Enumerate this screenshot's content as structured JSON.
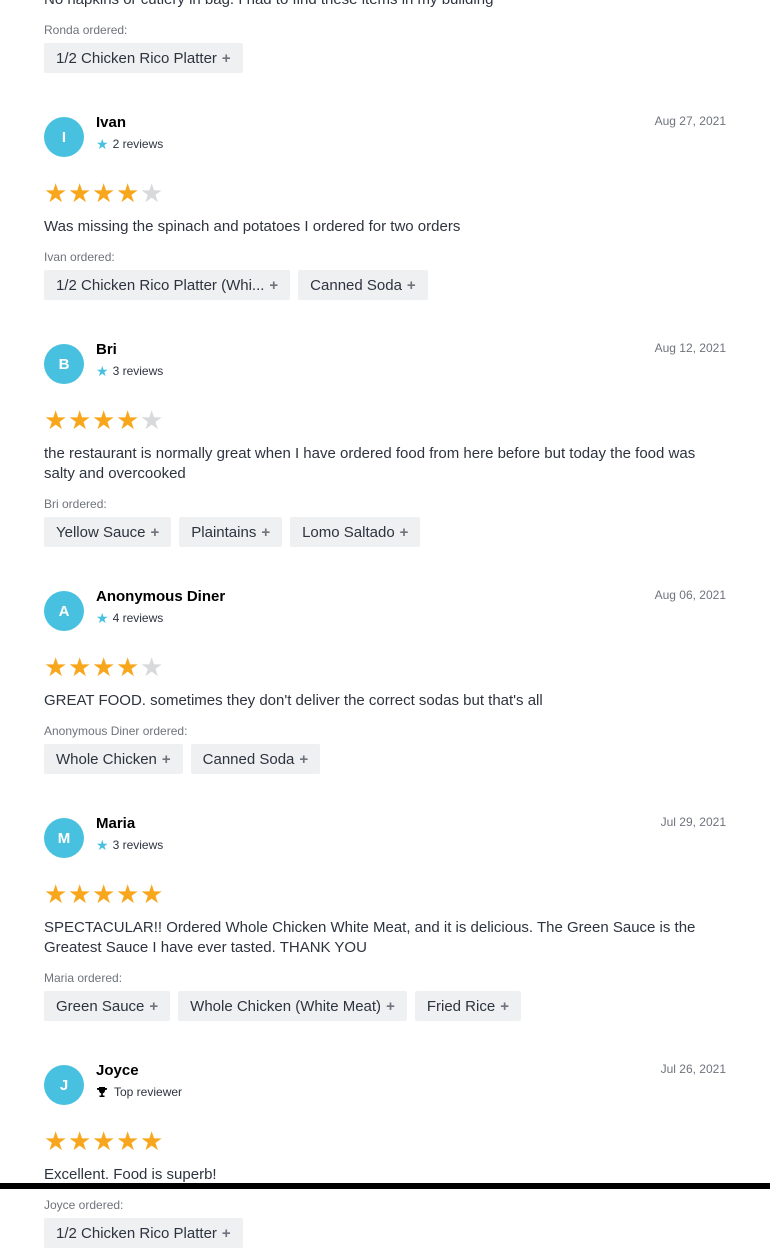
{
  "top": {
    "text": "No napkins or cutlery in bag. I had to find these items in my building",
    "ordered_label": "Ronda ordered:",
    "items": [
      "1/2 Chicken Rico Platter"
    ]
  },
  "reviews": [
    {
      "initial": "I",
      "name": "Ivan",
      "meta": "2 reviews",
      "date": "Aug 27, 2021",
      "rating": 4,
      "text": "Was missing the spinach and potatoes I ordered for two orders",
      "ordered_label": "Ivan ordered:",
      "items": [
        "1/2 Chicken Rico Platter (Whi...",
        "Canned Soda"
      ]
    },
    {
      "initial": "B",
      "name": "Bri",
      "meta": "3 reviews",
      "date": "Aug 12, 2021",
      "rating": 4,
      "text": "the restaurant is normally great when I have ordered food from here before but today the food was salty and overcooked",
      "ordered_label": "Bri ordered:",
      "items": [
        "Yellow Sauce",
        "Plaintains",
        "Lomo Saltado"
      ]
    },
    {
      "initial": "A",
      "name": "Anonymous Diner",
      "meta": "4 reviews",
      "date": "Aug 06, 2021",
      "rating": 4,
      "text": "GREAT FOOD. sometimes they don't deliver the correct sodas but that's all",
      "ordered_label": "Anonymous Diner ordered:",
      "items": [
        "Whole Chicken",
        "Canned Soda"
      ]
    },
    {
      "initial": "M",
      "name": "Maria",
      "meta": "3 reviews",
      "date": "Jul 29, 2021",
      "rating": 5,
      "text": "SPECTACULAR!! Ordered Whole Chicken White Meat, and it is delicious. The Green Sauce is the Greatest Sauce I have ever tasted. THANK YOU",
      "ordered_label": "Maria ordered:",
      "items": [
        "Green Sauce",
        "Whole Chicken (White Meat)",
        "Fried Rice"
      ]
    },
    {
      "initial": "J",
      "name": "Joyce",
      "meta": "Top reviewer",
      "meta_icon": "trophy-icon",
      "date": "Jul 26, 2021",
      "rating": 5,
      "text": "Excellent. Food is superb!",
      "ordered_label": "Joyce ordered:",
      "items": [
        "1/2 Chicken Rico Platter"
      ]
    }
  ],
  "colors": {
    "avatar": "#47c1df",
    "star_on": "#f8a71d",
    "star_off": "#d8d9db",
    "chip_bg": "#eef0f2"
  }
}
